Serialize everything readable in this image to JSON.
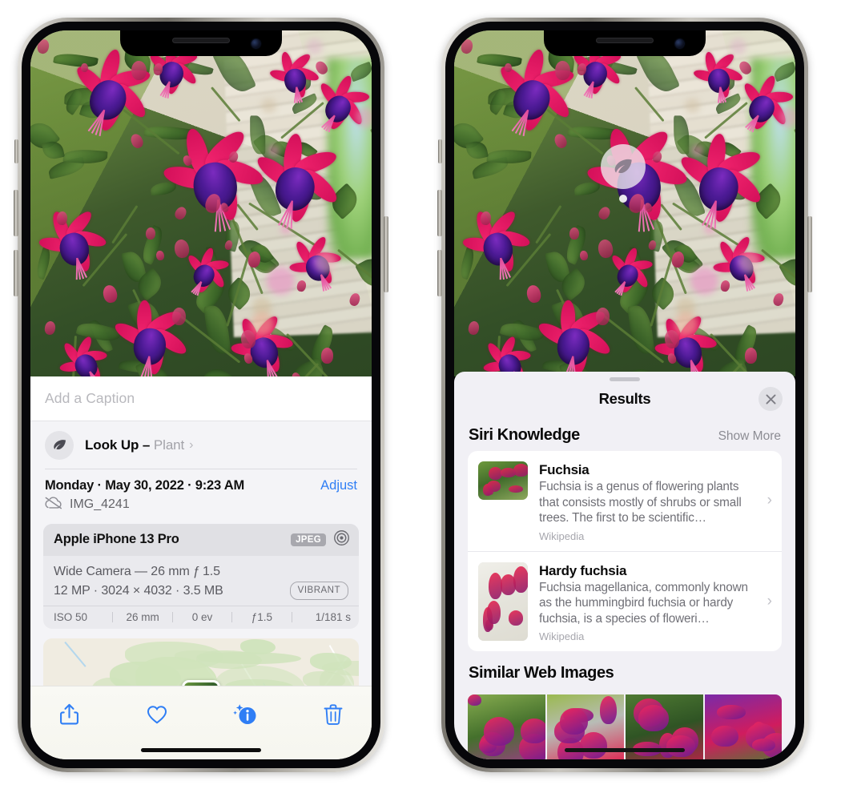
{
  "left_phone": {
    "caption": {
      "placeholder": "Add a Caption",
      "value": ""
    },
    "lookup": {
      "icon": "leaf-icon",
      "label": "Look Up – ",
      "subject": "Plant",
      "chevron": "›"
    },
    "info": {
      "date": "Monday · May 30, 2022 · 9:23 AM",
      "adjust_label": "Adjust",
      "cloud_icon": "cloud-slash-icon",
      "filename": "IMG_4241"
    },
    "metadata": {
      "device": "Apple iPhone 13 Pro",
      "format_badge": "JPEG",
      "raw_icon": "aperture-icon",
      "lens_line": "Wide Camera — 26 mm ƒ 1.5",
      "size_line": "12 MP · 3024 × 4032 · 3.5 MB",
      "style_badge": "VIBRANT",
      "exif": [
        "ISO 50",
        "26 mm",
        "0 ev",
        "ƒ1.5",
        "1/181 s"
      ]
    },
    "toolbar": [
      {
        "name": "share-icon",
        "label": "Share"
      },
      {
        "name": "heart-icon",
        "label": "Favorite"
      },
      {
        "name": "info-sparkle-icon",
        "label": "Info"
      },
      {
        "name": "trash-icon",
        "label": "Delete"
      }
    ]
  },
  "right_phone": {
    "visual_lookup_badge": {
      "icon": "leaf-icon"
    },
    "sheet": {
      "title": "Results",
      "close_icon": "close-icon",
      "grabber": "drag-handle"
    },
    "siri_knowledge": {
      "section_title": "Siri Knowledge",
      "show_more": "Show More",
      "items": [
        {
          "title": "Fuchsia",
          "description": "Fuchsia is a genus of flowering plants that consists mostly of shrubs or small trees. The first to be scientific…",
          "source": "Wikipedia",
          "chevron": "›"
        },
        {
          "title": "Hardy fuchsia",
          "description": "Fuchsia magellanica, commonly known as the hummingbird fuchsia or hardy fuchsia, is a species of floweri…",
          "source": "Wikipedia",
          "chevron": "›"
        }
      ]
    },
    "similar_web_images": {
      "section_title": "Similar Web Images",
      "count": 4
    }
  },
  "colors": {
    "accent_blue": "#2f7ef5",
    "sheet_bg": "#f1f0f5",
    "info_bg": "#f4f4f7",
    "card_bg": "#ffffff",
    "meta_card_bg": "#eaeaee",
    "muted_text": "#8c8c93"
  }
}
